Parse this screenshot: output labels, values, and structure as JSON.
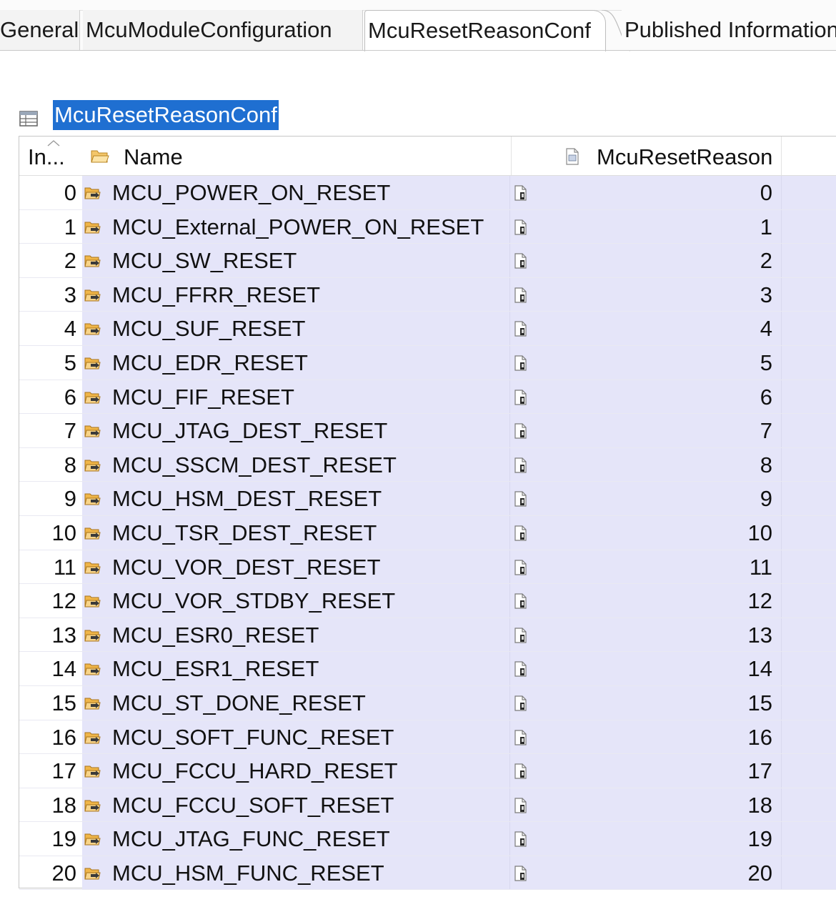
{
  "tabs": [
    {
      "label": "General"
    },
    {
      "label": "McuModuleConfiguration"
    },
    {
      "label": "McuResetReasonConf"
    },
    {
      "label": "Published Information"
    }
  ],
  "section": {
    "title": "McuResetReasonConf",
    "icon": "table-icon"
  },
  "table": {
    "headers": {
      "index": "In...",
      "name": "Name",
      "reason": "McuResetReason"
    },
    "rows": [
      {
        "index": "0",
        "name": "MCU_POWER_ON_RESET",
        "value": "0"
      },
      {
        "index": "1",
        "name": "MCU_External_POWER_ON_RESET",
        "value": "1"
      },
      {
        "index": "2",
        "name": "MCU_SW_RESET",
        "value": "2"
      },
      {
        "index": "3",
        "name": "MCU_FFRR_RESET",
        "value": "3"
      },
      {
        "index": "4",
        "name": "MCU_SUF_RESET",
        "value": "4"
      },
      {
        "index": "5",
        "name": "MCU_EDR_RESET",
        "value": "5"
      },
      {
        "index": "6",
        "name": "MCU_FIF_RESET",
        "value": "6"
      },
      {
        "index": "7",
        "name": "MCU_JTAG_DEST_RESET",
        "value": "7"
      },
      {
        "index": "8",
        "name": "MCU_SSCM_DEST_RESET",
        "value": "8"
      },
      {
        "index": "9",
        "name": "MCU_HSM_DEST_RESET",
        "value": "9"
      },
      {
        "index": "10",
        "name": "MCU_TSR_DEST_RESET",
        "value": "10"
      },
      {
        "index": "11",
        "name": "MCU_VOR_DEST_RESET",
        "value": "11"
      },
      {
        "index": "12",
        "name": "MCU_VOR_STDBY_RESET",
        "value": "12"
      },
      {
        "index": "13",
        "name": "MCU_ESR0_RESET",
        "value": "13"
      },
      {
        "index": "14",
        "name": "MCU_ESR1_RESET",
        "value": "14"
      },
      {
        "index": "15",
        "name": "MCU_ST_DONE_RESET",
        "value": "15"
      },
      {
        "index": "16",
        "name": "MCU_SOFT_FUNC_RESET",
        "value": "16"
      },
      {
        "index": "17",
        "name": "MCU_FCCU_HARD_RESET",
        "value": "17"
      },
      {
        "index": "18",
        "name": "MCU_FCCU_SOFT_RESET",
        "value": "18"
      },
      {
        "index": "19",
        "name": "MCU_JTAG_FUNC_RESET",
        "value": "19"
      },
      {
        "index": "20",
        "name": "MCU_HSM_FUNC_RESET",
        "value": "20"
      }
    ]
  },
  "colors": {
    "selection": "#1f6fd1",
    "row_band": "#e5e5f9",
    "folder": "#e8a530"
  }
}
